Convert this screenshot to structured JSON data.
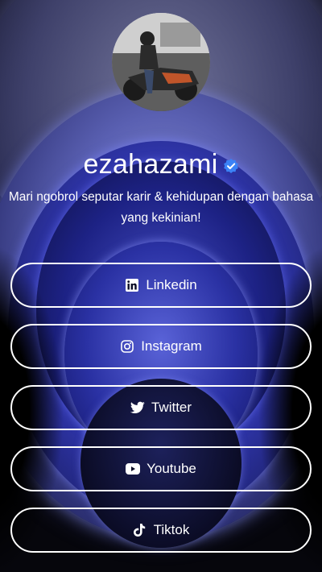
{
  "profile": {
    "username": "ezahazami",
    "bio": "Mari ngobrol seputar karir & kehidupan dengan bahasa yang kekinian!"
  },
  "links": [
    {
      "label": "Linkedin",
      "icon": "linkedin-icon"
    },
    {
      "label": "Instagram",
      "icon": "instagram-icon"
    },
    {
      "label": "Twitter",
      "icon": "twitter-icon"
    },
    {
      "label": "Youtube",
      "icon": "youtube-icon"
    },
    {
      "label": "Tiktok",
      "icon": "tiktok-icon"
    }
  ],
  "colors": {
    "text": "#ffffff",
    "verified_badge": "#3b82f6",
    "background": "#06060c"
  }
}
